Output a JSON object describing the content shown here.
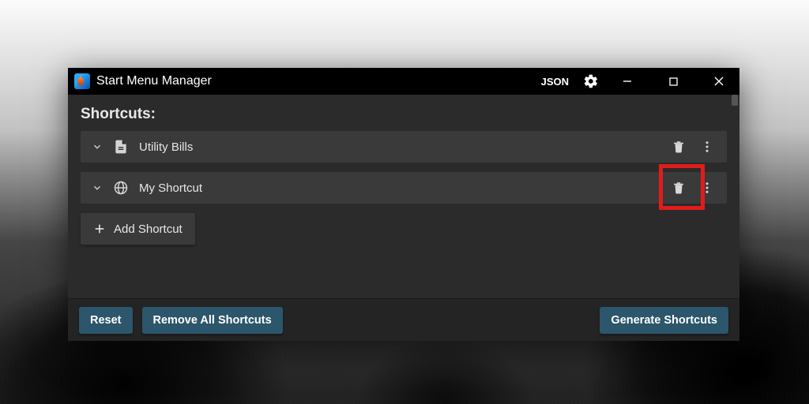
{
  "window": {
    "title": "Start Menu Manager",
    "json_button": "JSON"
  },
  "section": {
    "heading": "Shortcuts:"
  },
  "shortcuts": [
    {
      "label": "Utility Bills",
      "icon": "document"
    },
    {
      "label": "My Shortcut",
      "icon": "globe"
    }
  ],
  "add_button": "Add Shortcut",
  "footer": {
    "reset": "Reset",
    "remove_all": "Remove All Shortcuts",
    "generate": "Generate Shortcuts"
  },
  "highlight": {
    "target": "shortcut-1-delete"
  }
}
